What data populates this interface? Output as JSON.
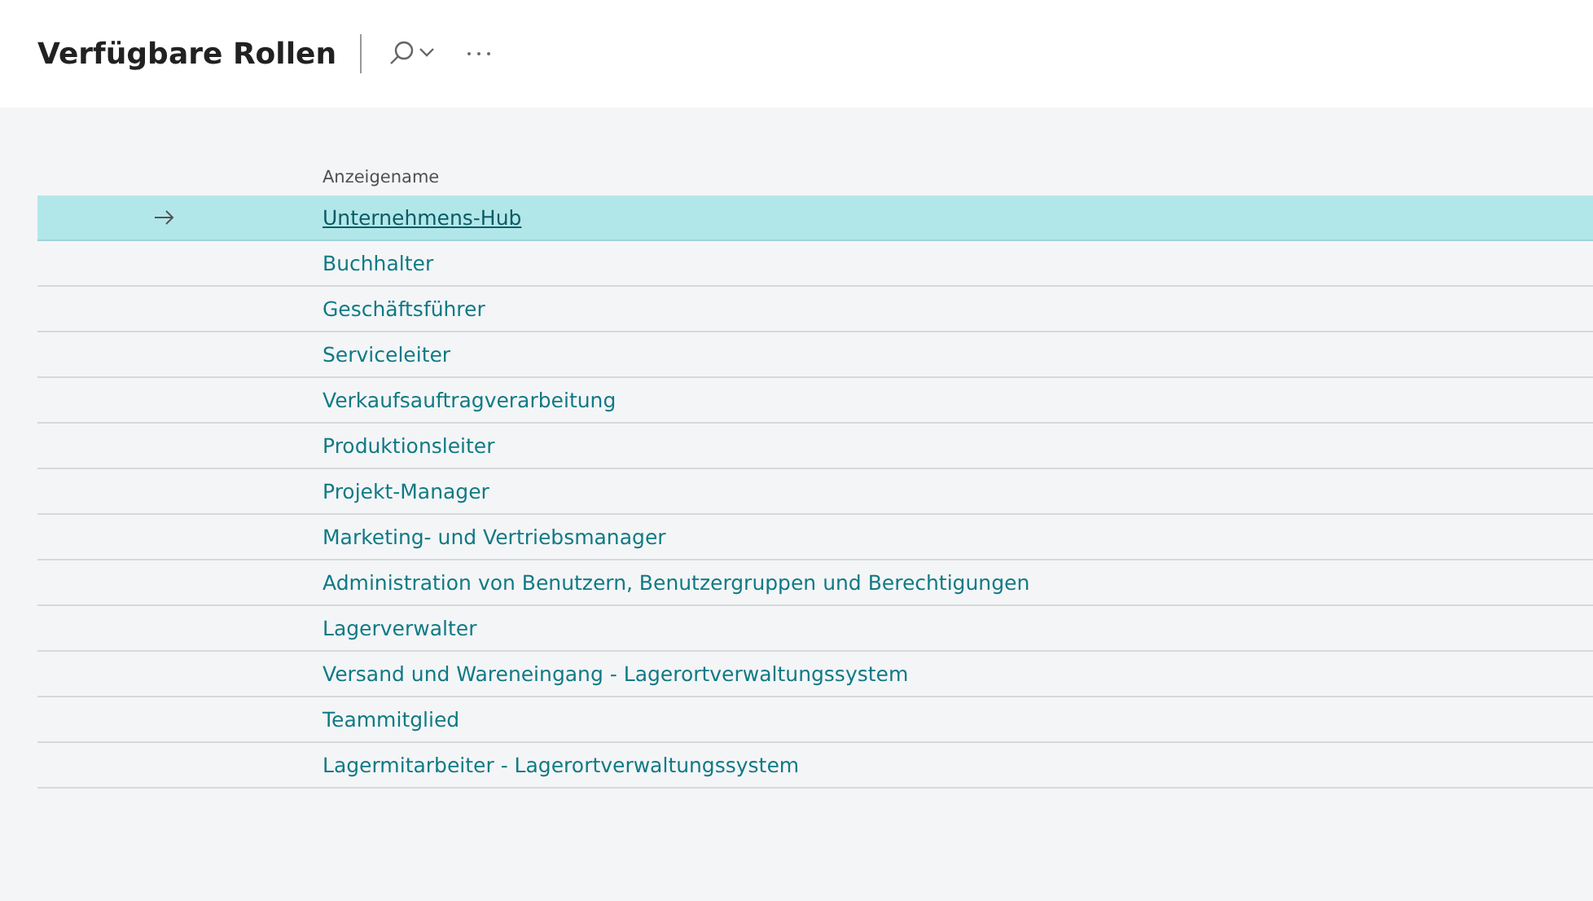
{
  "page": {
    "title": "Verfügbare Rollen"
  },
  "table": {
    "columns": [
      "Anzeigename"
    ],
    "rows": [
      {
        "name": "Unternehmens-Hub",
        "selected": true
      },
      {
        "name": "Buchhalter",
        "selected": false
      },
      {
        "name": "Geschäftsführer",
        "selected": false
      },
      {
        "name": "Serviceleiter",
        "selected": false
      },
      {
        "name": "Verkaufsauftragverarbeitung",
        "selected": false
      },
      {
        "name": "Produktionsleiter",
        "selected": false
      },
      {
        "name": "Projekt-Manager",
        "selected": false
      },
      {
        "name": "Marketing- und Vertriebsmanager",
        "selected": false
      },
      {
        "name": "Administration von Benutzern, Benutzergruppen und Berechtigungen",
        "selected": false
      },
      {
        "name": "Lagerverwalter",
        "selected": false
      },
      {
        "name": "Versand und Wareneingang - Lagerortverwaltungssystem",
        "selected": false
      },
      {
        "name": "Teammitglied",
        "selected": false
      },
      {
        "name": "Lagermitarbeiter - Lagerortverwaltungssystem",
        "selected": false
      }
    ]
  }
}
